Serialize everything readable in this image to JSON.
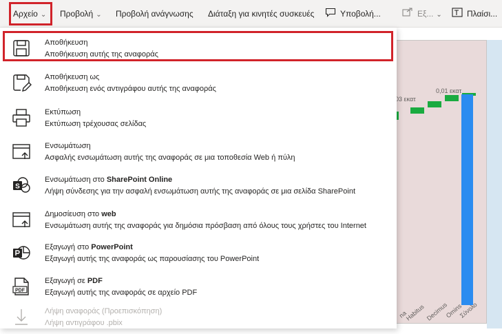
{
  "menubar": {
    "items": [
      {
        "label": "Αρχείο",
        "chevron": true
      },
      {
        "label": "Προβολή",
        "chevron": true
      },
      {
        "label": "Προβολή ανάγνωσης",
        "chevron": false
      },
      {
        "label": "Διάταξη για κινητές συσκευές",
        "chevron": false
      },
      {
        "label": "Υποβολή...",
        "icon": "comment-icon",
        "chevron": false
      },
      {
        "label": "Εξ...",
        "icon": "export-icon",
        "chevron": true
      },
      {
        "label": "Πλαίσι...",
        "icon": "textbox-icon",
        "chevron": false
      }
    ]
  },
  "file_menu": {
    "items": [
      {
        "title": "Αποθήκευση",
        "title_bold": "",
        "desc": "Αποθήκευση αυτής της αναφοράς",
        "icon": "save-icon",
        "enabled": true,
        "highlighted": true
      },
      {
        "title": "Αποθήκευση ως",
        "title_bold": "",
        "desc": "Αποθήκευση ενός αντιγράφου αυτής της αναφοράς",
        "icon": "save-as-icon",
        "enabled": true
      },
      {
        "title": "Εκτύπωση",
        "title_bold": "",
        "desc": "Εκτύπωση τρέχουσας σελίδας",
        "icon": "print-icon",
        "enabled": true
      },
      {
        "title": "Ενσωμάτωση",
        "title_bold": "",
        "desc": "Ασφαλής ενσωμάτωση αυτής της αναφοράς σε μια τοποθεσία Web ή πύλη",
        "icon": "embed-icon",
        "enabled": true
      },
      {
        "title": "Ενσωμάτωση στο ",
        "title_bold": "SharePoint Online",
        "desc": "Λήψη σύνδεσης για την ασφαλή ενσωμάτωση αυτής της αναφοράς σε μια σελίδα SharePoint",
        "icon": "sharepoint-icon",
        "enabled": true
      },
      {
        "title": "Δημοσίευση στο ",
        "title_bold": "web",
        "desc": "Ενσωμάτωση αυτής της αναφοράς για δημόσια πρόσβαση από όλους τους χρήστες του Internet",
        "icon": "publish-web-icon",
        "enabled": true
      },
      {
        "title": "Εξαγωγή στο ",
        "title_bold": "PowerPoint",
        "desc": "Εξαγωγή αυτής της αναφοράς ως παρουσίασης του PowerPoint",
        "icon": "powerpoint-icon",
        "enabled": true
      },
      {
        "title": "Εξαγωγή σε ",
        "title_bold": "PDF",
        "desc": "Εξαγωγή αυτής της αναφοράς σε αρχείο PDF",
        "icon": "pdf-icon",
        "enabled": true
      },
      {
        "title": "Λήψη αναφοράς (Προεπισκόπηση)",
        "title_bold": "",
        "desc": "Λήψη αντιγράφου .pbix",
        "icon": "download-icon",
        "enabled": false
      }
    ],
    "pdf_icon_text": "PDF",
    "sharepoint_icon_text": "S"
  },
  "background_chart": {
    "data_labels": [
      "03 εκατ",
      "0,01 εκατ"
    ],
    "axis_labels": [
      "na",
      "Habitus",
      "Decimus",
      "Omins",
      "Σύνολο"
    ]
  },
  "colors": {
    "highlight": "#d1232a",
    "waterfall_green": "#1aab40",
    "waterfall_total": "#2b8cf0"
  }
}
